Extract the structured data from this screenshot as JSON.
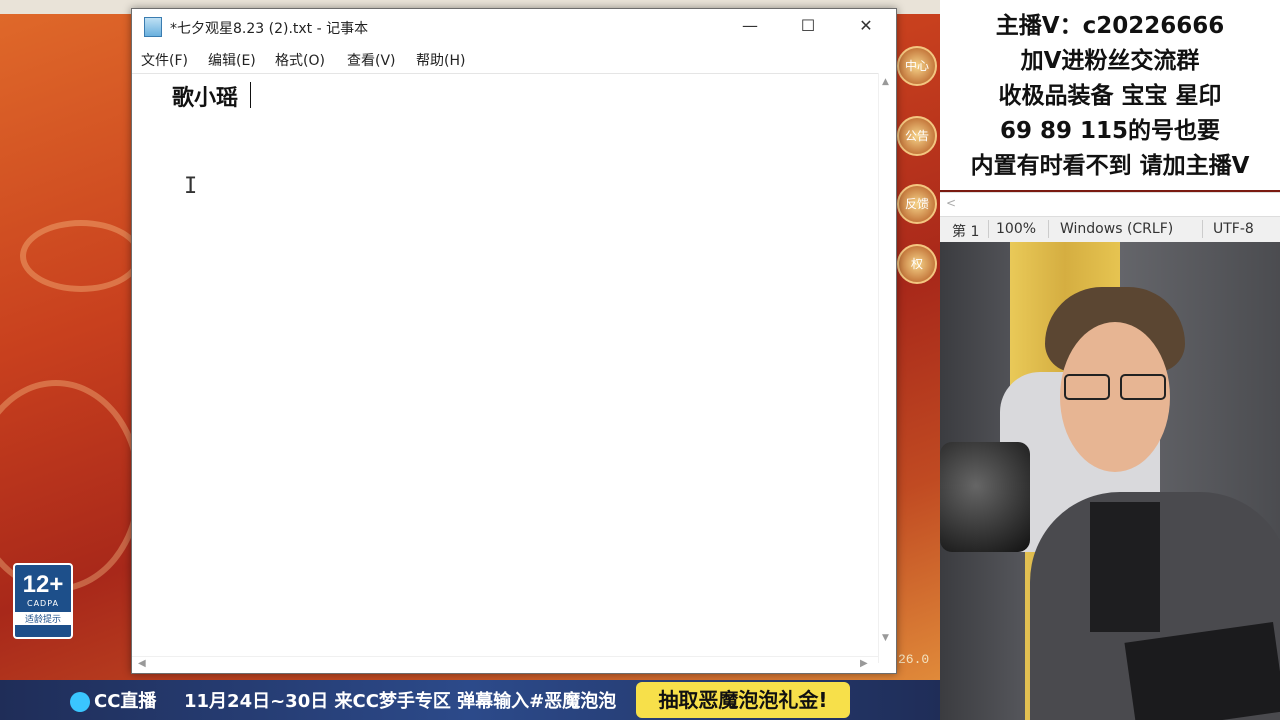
{
  "notepad": {
    "title": "*七夕观星8.23 (2).txt - 记事本",
    "menu": [
      "文件(F)",
      "编辑(E)",
      "格式(O)",
      "查看(V)",
      "帮助(H)"
    ],
    "content": "歌小瑶",
    "window_buttons": {
      "minimize": "—",
      "maximize": "☐",
      "close": "✕"
    }
  },
  "status_bar": {
    "line": "第 1",
    "zoom": "100%",
    "line_ending": "Windows (CRLF)",
    "encoding": "UTF-8"
  },
  "stream_info": {
    "lines": [
      "主播V：c20226666",
      "加V进粉丝交流群",
      "收极品装备 宝宝 星印",
      "69 89 115的号也要",
      "内置有时看不到 请加主播V"
    ]
  },
  "game": {
    "age_rating": "12+",
    "age_org": "CADPA",
    "age_tip": "适龄提示",
    "side_icons": [
      "中心",
      "公告",
      "反馈",
      "权"
    ],
    "version": "26.0"
  },
  "banner": {
    "logo": "CC直播",
    "message": "11月24日~30日 来CC梦手专区 弹幕输入#恶魔泡泡",
    "promo": "抽取恶魔泡泡礼金!"
  }
}
